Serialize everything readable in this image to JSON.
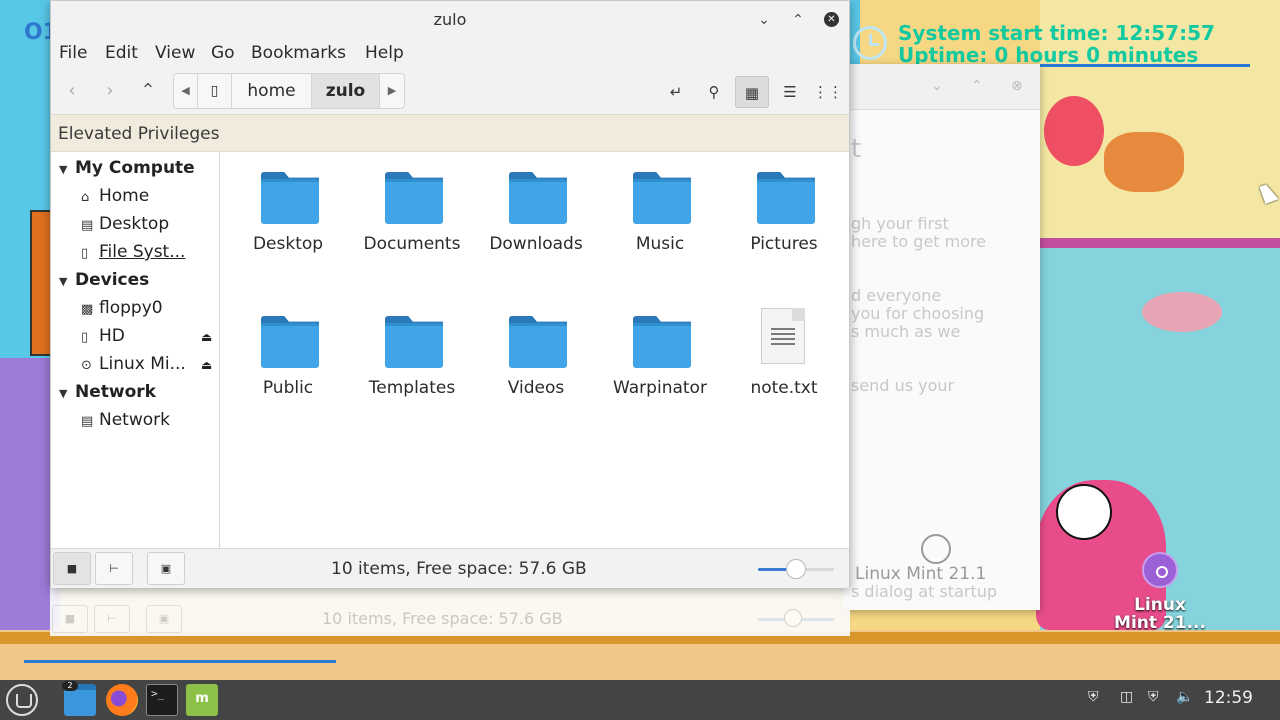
{
  "desktop": {
    "conky_start_label": "System start time:",
    "conky_start_value": "12:57:57",
    "conky_uptime_label": "Uptime:",
    "conky_uptime_value": "0 hours 0 minutes",
    "left_partial_text": "O1",
    "mint_label_line1": "Linux",
    "mint_label_line2": "Mint 21..."
  },
  "background_window": {
    "heading_partial": "t",
    "text_line1": "gh your first",
    "text_line2": "here to get more",
    "text_line3": "d everyone",
    "text_line4": "you for choosing",
    "text_line5": "s much as we",
    "text_line6": "send us your",
    "brand": "Linux Mint 21.1",
    "footer": "s dialog at startup"
  },
  "file_manager": {
    "title": "zulo",
    "menu": [
      "File",
      "Edit",
      "View",
      "Go",
      "Bookmarks",
      "Help"
    ],
    "breadcrumb": [
      "home",
      "zulo"
    ],
    "infobar": "Elevated Privileges",
    "sidebar": {
      "computer_header": "My Compute",
      "computer_items": [
        "Home",
        "Desktop",
        "File Syst..."
      ],
      "devices_header": "Devices",
      "devices_items": [
        "floppy0",
        "HD",
        "Linux Mi..."
      ],
      "network_header": "Network",
      "network_items": [
        "Network"
      ]
    },
    "files": [
      {
        "name": "Desktop",
        "type": "folder"
      },
      {
        "name": "Documents",
        "type": "folder"
      },
      {
        "name": "Downloads",
        "type": "folder"
      },
      {
        "name": "Music",
        "type": "folder"
      },
      {
        "name": "Pictures",
        "type": "folder"
      },
      {
        "name": "Public",
        "type": "folder"
      },
      {
        "name": "Templates",
        "type": "folder"
      },
      {
        "name": "Videos",
        "type": "folder"
      },
      {
        "name": "Warpinator",
        "type": "folder"
      },
      {
        "name": "note.txt",
        "type": "text"
      }
    ],
    "status": "10 items, Free space: 57.6 GB",
    "zoom_level": 0.5
  },
  "ghost_window": {
    "status": "10 items, Free space: 57.6 GB"
  },
  "taskbar": {
    "clock": "12:59",
    "files_badge": "2",
    "terminal_glyph": ">_"
  },
  "colors": {
    "folder_front": "#3fa5e6",
    "folder_back": "#2b79b8",
    "conky_text": "#12c9a0",
    "accent": "#3a7bd5"
  }
}
